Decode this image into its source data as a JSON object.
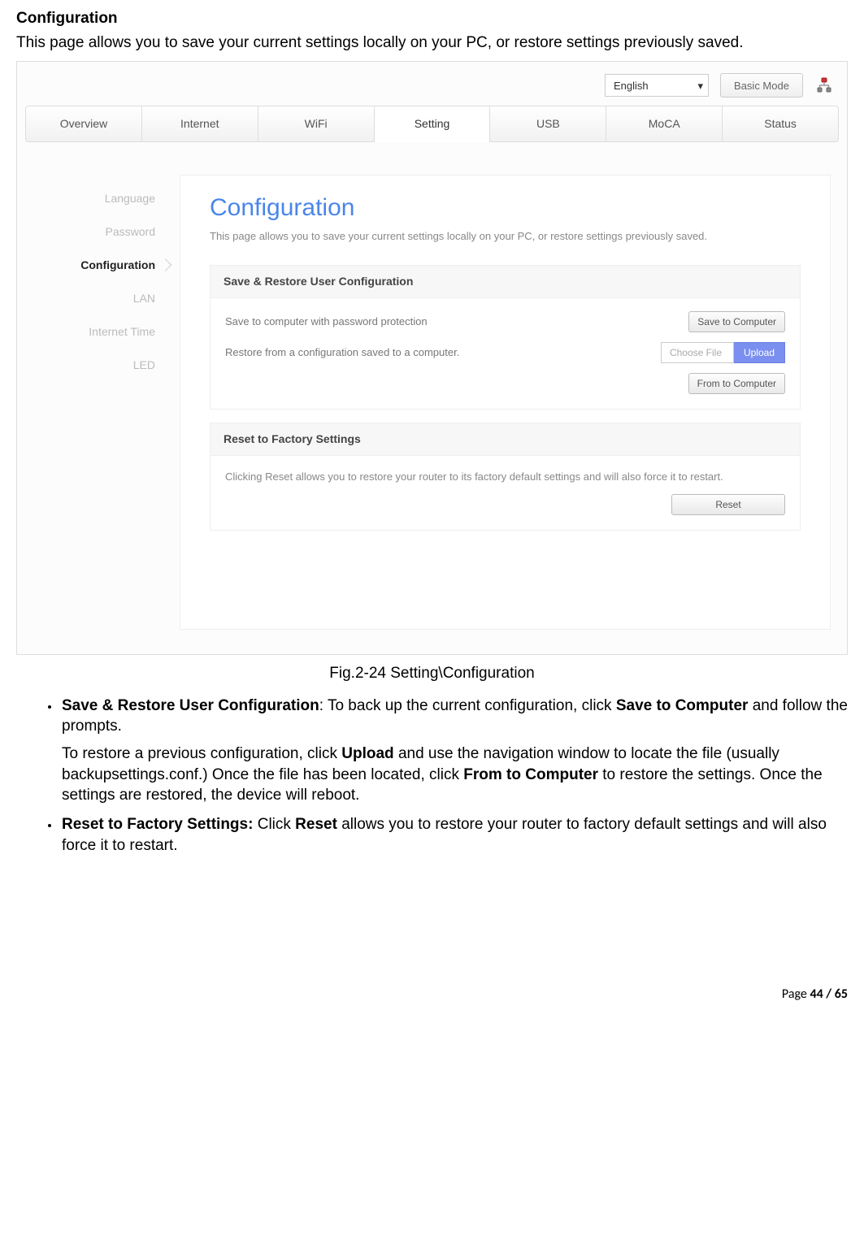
{
  "doc": {
    "heading": "Configuration",
    "intro": "This page allows you to save your current settings locally on your PC, or restore settings previously saved.",
    "figure_caption": "Fig.2-24 Setting\\Configuration",
    "bullet1_label": "Save & Restore User Configuration",
    "bullet1_p1a": ": To back up the current configuration, click ",
    "bullet1_p1b": "Save to Computer",
    "bullet1_p1c": " and follow the prompts.",
    "bullet1_p2a": "To restore a previous configuration, click ",
    "bullet1_p2b": "Upload",
    "bullet1_p2c": " and use the navigation window to locate the file (usually backupsettings.conf.) Once the file has been located, click ",
    "bullet1_p2d": "From to Computer",
    "bullet1_p2e": " to restore the settings. Once the settings are restored, the device will reboot.",
    "bullet2_label": "Reset to Factory Settings:",
    "bullet2_a": " Click ",
    "bullet2_b": "Reset",
    "bullet2_c": " allows you to restore your router to factory default settings and will also force it to restart.",
    "footer_prefix": "Page ",
    "footer_page": "44 / 65"
  },
  "shot": {
    "lang": "English",
    "basic_mode": "Basic Mode",
    "tabs": [
      "Overview",
      "Internet",
      "WiFi",
      "Setting",
      "USB",
      "MoCA",
      "Status"
    ],
    "sidebar": [
      "Language",
      "Password",
      "Configuration",
      "LAN",
      "Internet Time",
      "LED"
    ],
    "sidebar_active_index": 2,
    "title": "Configuration",
    "subtitle": "This page allows you to save your current settings locally on your PC, or restore settings previously saved.",
    "section1_head": "Save & Restore User Configuration",
    "save_row_text": "Save to computer with password protection",
    "save_btn": "Save to Computer",
    "restore_row_text": "Restore from a configuration saved to a computer.",
    "choose_file": "Choose File",
    "upload": "Upload",
    "from_btn": "From to Computer",
    "section2_head": "Reset to Factory Settings",
    "reset_desc": "Clicking Reset allows you to restore your router to its factory default settings and will also force it to restart.",
    "reset_btn": "Reset"
  }
}
